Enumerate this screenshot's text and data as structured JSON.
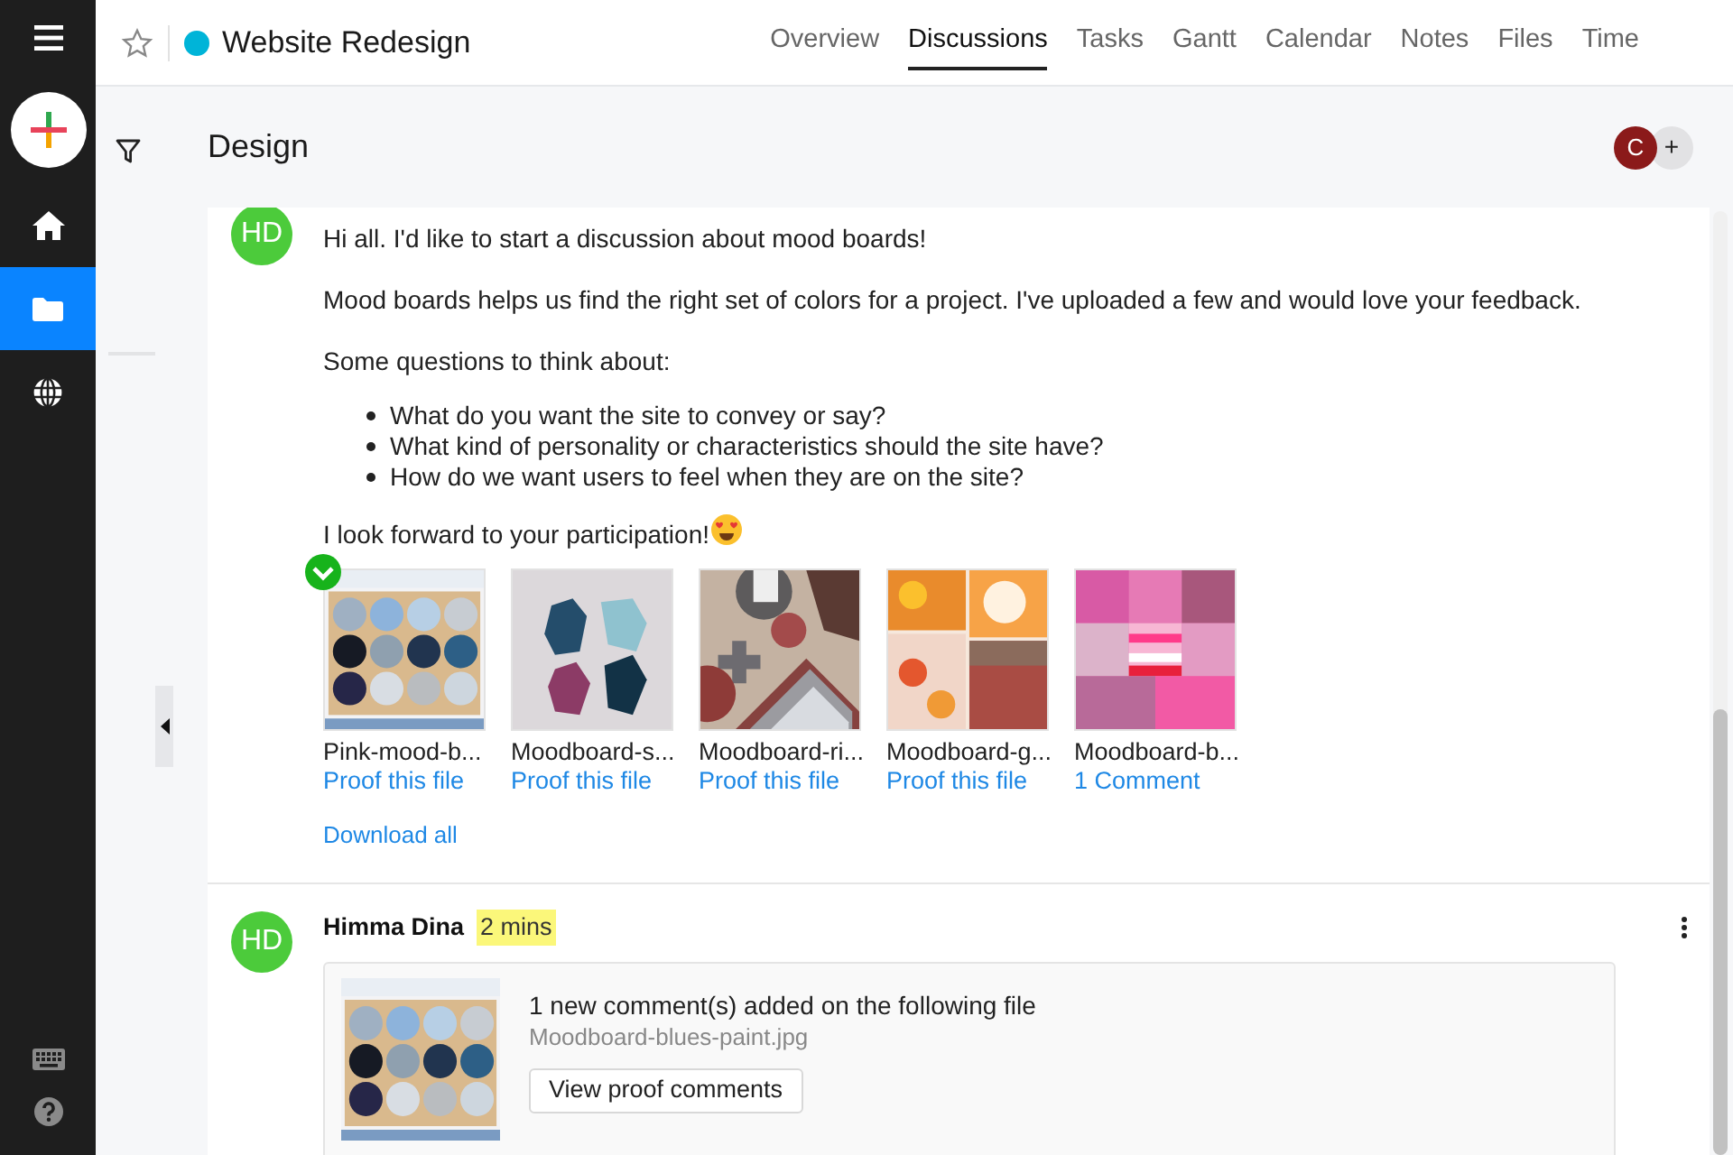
{
  "sidebar": {
    "items": [
      {
        "kind": "home",
        "selected": false
      },
      {
        "kind": "folder",
        "selected": true
      },
      {
        "kind": "globe",
        "selected": false
      }
    ]
  },
  "header": {
    "title": "Website Redesign",
    "color": "#00b4d8",
    "starred": false,
    "tabs": [
      {
        "label": "Overview",
        "selected": false
      },
      {
        "label": "Discussions",
        "selected": true
      },
      {
        "label": "Tasks",
        "selected": false
      },
      {
        "label": "Gantt",
        "selected": false
      },
      {
        "label": "Calendar",
        "selected": false
      },
      {
        "label": "Notes",
        "selected": false
      },
      {
        "label": "Files",
        "selected": false
      },
      {
        "label": "Time",
        "selected": false
      }
    ]
  },
  "section": {
    "title": "Design",
    "members": [
      {
        "initial": "C",
        "color": "#8b1a1a"
      }
    ],
    "add_label": "+"
  },
  "posts": [
    {
      "avatar": "HD",
      "paragraphs": [
        "Hi all. I'd like to start a discussion about mood boards!",
        "Mood boards helps us find the right set of colors for a project. I've uploaded a few and would love your feedback.",
        "Some questions to think about:"
      ],
      "bullets": [
        "What do you want the site to convey or say?",
        "What kind of personality or characteristics should the site have?",
        "How do we want users to feel when they are on the site?"
      ],
      "closing": "I look forward to your participation!",
      "files": [
        {
          "name": "Pink-mood-b...",
          "action": "Proof this file",
          "approved": true
        },
        {
          "name": "Moodboard-s...",
          "action": "Proof this file",
          "approved": false
        },
        {
          "name": "Moodboard-ri...",
          "action": "Proof this file",
          "approved": false
        },
        {
          "name": "Moodboard-g...",
          "action": "Proof this file",
          "approved": false
        },
        {
          "name": "Moodboard-b...",
          "action": "1 Comment",
          "approved": false
        }
      ],
      "download": "Download all"
    },
    {
      "avatar": "HD",
      "author": "Himma Dina",
      "time": "2 mins",
      "notice": {
        "text": "1 new comment(s) added on the following file",
        "file": "Moodboard-blues-paint.jpg",
        "button": "View proof comments"
      }
    }
  ]
}
